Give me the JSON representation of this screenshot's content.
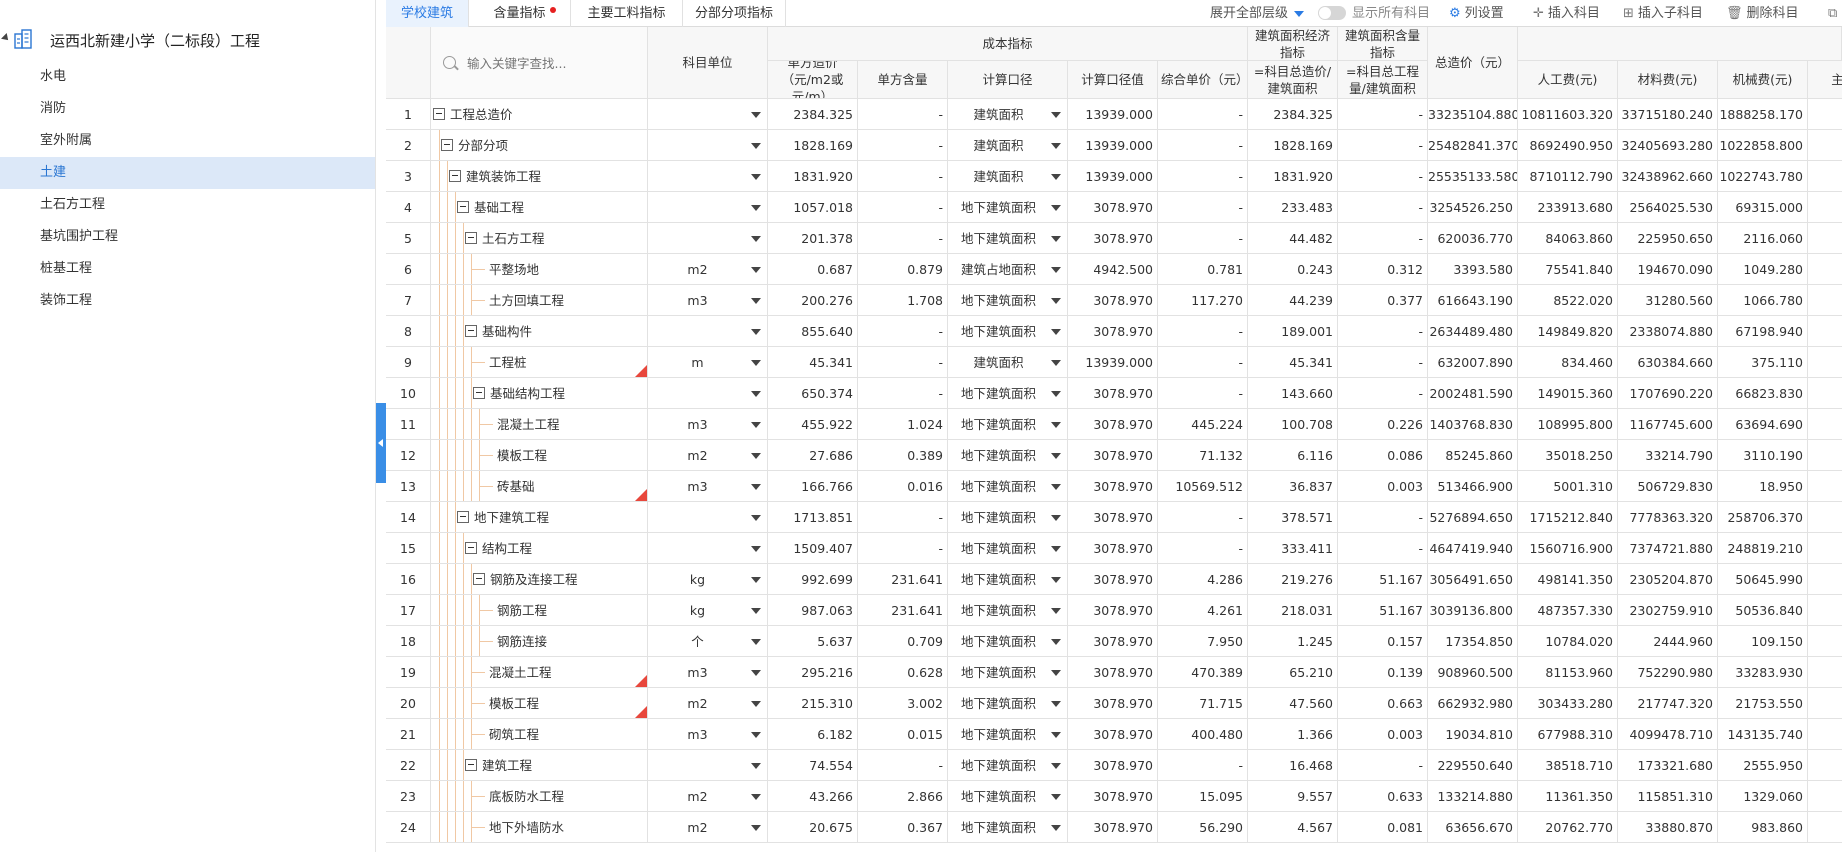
{
  "sidebar": {
    "project_title": "运西北新建小学（二标段）工程",
    "items": [
      {
        "label": "水电",
        "active": false
      },
      {
        "label": "消防",
        "active": false
      },
      {
        "label": "室外附属",
        "active": false
      },
      {
        "label": "土建",
        "active": true
      },
      {
        "label": "土石方工程",
        "active": false
      },
      {
        "label": "基坑围护工程",
        "active": false
      },
      {
        "label": "桩基工程",
        "active": false
      },
      {
        "label": "装饰工程",
        "active": false
      }
    ]
  },
  "tabs": [
    {
      "label": "学校建筑",
      "active": true,
      "dot": false
    },
    {
      "label": "含量指标",
      "active": false,
      "dot": true
    },
    {
      "label": "主要工料指标",
      "active": false,
      "dot": false
    },
    {
      "label": "分部分项指标",
      "active": false,
      "dot": false
    }
  ],
  "toolbar": {
    "expand_label": "展开全部层级",
    "show_all_label": "显示所有科目",
    "column_settings": "列设置",
    "insert_item": "插入科目",
    "insert_child": "插入子科目",
    "delete_item": "删除科目"
  },
  "search": {
    "placeholder": "输入关键字查找..."
  },
  "headers": {
    "unit": "科目单位",
    "cost_group": "成本指标",
    "unit_cost": "单方造价（元/m2或元/m）",
    "unit_qty": "单方含量",
    "calc_basis": "计算口径",
    "calc_value": "计算口径值",
    "comp_price": "综合单价（元）",
    "area_econ": "建筑面积经济指标",
    "area_econ_formula": "=科目总造价/建筑面积",
    "area_qty": "建筑面积含量指标",
    "area_qty_formula": "=科目总工程量/建筑面积",
    "total": "总造价（元）",
    "labor": "人工费(元)",
    "material": "材料费(元)",
    "machine": "机械费(元)",
    "main_partial": "主"
  },
  "rows": [
    {
      "no": "1",
      "level": 0,
      "exp": true,
      "name": "工程总造价",
      "unit": "",
      "flag": false,
      "unit_cost": "2384.325",
      "unit_qty": "-",
      "basis": "建筑面积",
      "basis_val": "13939.000",
      "comp": "-",
      "econ": "2384.325",
      "qtyi": "-",
      "total": "33235104.880",
      "labor": "10811603.320",
      "material": "33715180.240",
      "machine": "1888258.170"
    },
    {
      "no": "2",
      "level": 1,
      "exp": true,
      "name": "分部分项",
      "unit": "",
      "flag": false,
      "unit_cost": "1828.169",
      "unit_qty": "-",
      "basis": "建筑面积",
      "basis_val": "13939.000",
      "comp": "-",
      "econ": "1828.169",
      "qtyi": "-",
      "total": "25482841.370",
      "labor": "8692490.950",
      "material": "32405693.280",
      "machine": "1022858.800"
    },
    {
      "no": "3",
      "level": 2,
      "exp": true,
      "name": "建筑装饰工程",
      "unit": "",
      "flag": false,
      "unit_cost": "1831.920",
      "unit_qty": "-",
      "basis": "建筑面积",
      "basis_val": "13939.000",
      "comp": "-",
      "econ": "1831.920",
      "qtyi": "-",
      "total": "25535133.580",
      "labor": "8710112.790",
      "material": "32438962.660",
      "machine": "1022743.780"
    },
    {
      "no": "4",
      "level": 3,
      "exp": true,
      "name": "基础工程",
      "unit": "",
      "flag": false,
      "unit_cost": "1057.018",
      "unit_qty": "-",
      "basis": "地下建筑面积",
      "basis_val": "3078.970",
      "comp": "-",
      "econ": "233.483",
      "qtyi": "-",
      "total": "3254526.250",
      "labor": "233913.680",
      "material": "2564025.530",
      "machine": "69315.000"
    },
    {
      "no": "5",
      "level": 4,
      "exp": true,
      "name": "土石方工程",
      "unit": "",
      "flag": false,
      "unit_cost": "201.378",
      "unit_qty": "-",
      "basis": "地下建筑面积",
      "basis_val": "3078.970",
      "comp": "-",
      "econ": "44.482",
      "qtyi": "-",
      "total": "620036.770",
      "labor": "84063.860",
      "material": "225950.650",
      "machine": "2116.060"
    },
    {
      "no": "6",
      "level": 5,
      "exp": false,
      "name": "平整场地",
      "unit": "m2",
      "flag": false,
      "unit_cost": "0.687",
      "unit_qty": "0.879",
      "basis": "建筑占地面积",
      "basis_val": "4942.500",
      "comp": "0.781",
      "econ": "0.243",
      "qtyi": "0.312",
      "total": "3393.580",
      "labor": "75541.840",
      "material": "194670.090",
      "machine": "1049.280"
    },
    {
      "no": "7",
      "level": 5,
      "exp": false,
      "name": "土方回填工程",
      "unit": "m3",
      "flag": false,
      "unit_cost": "200.276",
      "unit_qty": "1.708",
      "basis": "地下建筑面积",
      "basis_val": "3078.970",
      "comp": "117.270",
      "econ": "44.239",
      "qtyi": "0.377",
      "total": "616643.190",
      "labor": "8522.020",
      "material": "31280.560",
      "machine": "1066.780"
    },
    {
      "no": "8",
      "level": 4,
      "exp": true,
      "name": "基础构件",
      "unit": "",
      "flag": false,
      "unit_cost": "855.640",
      "unit_qty": "-",
      "basis": "地下建筑面积",
      "basis_val": "3078.970",
      "comp": "-",
      "econ": "189.001",
      "qtyi": "-",
      "total": "2634489.480",
      "labor": "149849.820",
      "material": "2338074.880",
      "machine": "67198.940"
    },
    {
      "no": "9",
      "level": 5,
      "exp": false,
      "name": "工程桩",
      "unit": "m",
      "flag": true,
      "unit_cost": "45.341",
      "unit_qty": "-",
      "basis": "建筑面积",
      "basis_val": "13939.000",
      "comp": "-",
      "econ": "45.341",
      "qtyi": "-",
      "total": "632007.890",
      "labor": "834.460",
      "material": "630384.660",
      "machine": "375.110"
    },
    {
      "no": "10",
      "level": 5,
      "exp": true,
      "name": "基础结构工程",
      "unit": "",
      "flag": false,
      "unit_cost": "650.374",
      "unit_qty": "-",
      "basis": "地下建筑面积",
      "basis_val": "3078.970",
      "comp": "-",
      "econ": "143.660",
      "qtyi": "-",
      "total": "2002481.590",
      "labor": "149015.360",
      "material": "1707690.220",
      "machine": "66823.830"
    },
    {
      "no": "11",
      "level": 6,
      "exp": false,
      "name": "混凝土工程",
      "unit": "m3",
      "flag": false,
      "unit_cost": "455.922",
      "unit_qty": "1.024",
      "basis": "地下建筑面积",
      "basis_val": "3078.970",
      "comp": "445.224",
      "econ": "100.708",
      "qtyi": "0.226",
      "total": "1403768.830",
      "labor": "108995.800",
      "material": "1167745.600",
      "machine": "63694.690"
    },
    {
      "no": "12",
      "level": 6,
      "exp": false,
      "name": "模板工程",
      "unit": "m2",
      "flag": false,
      "unit_cost": "27.686",
      "unit_qty": "0.389",
      "basis": "地下建筑面积",
      "basis_val": "3078.970",
      "comp": "71.132",
      "econ": "6.116",
      "qtyi": "0.086",
      "total": "85245.860",
      "labor": "35018.250",
      "material": "33214.790",
      "machine": "3110.190"
    },
    {
      "no": "13",
      "level": 6,
      "exp": false,
      "name": "砖基础",
      "unit": "m3",
      "flag": true,
      "unit_cost": "166.766",
      "unit_qty": "0.016",
      "basis": "地下建筑面积",
      "basis_val": "3078.970",
      "comp": "10569.512",
      "econ": "36.837",
      "qtyi": "0.003",
      "total": "513466.900",
      "labor": "5001.310",
      "material": "506729.830",
      "machine": "18.950"
    },
    {
      "no": "14",
      "level": 3,
      "exp": true,
      "name": "地下建筑工程",
      "unit": "",
      "flag": false,
      "unit_cost": "1713.851",
      "unit_qty": "-",
      "basis": "地下建筑面积",
      "basis_val": "3078.970",
      "comp": "-",
      "econ": "378.571",
      "qtyi": "-",
      "total": "5276894.650",
      "labor": "1715212.840",
      "material": "7778363.320",
      "machine": "258706.370"
    },
    {
      "no": "15",
      "level": 4,
      "exp": true,
      "name": "结构工程",
      "unit": "",
      "flag": false,
      "unit_cost": "1509.407",
      "unit_qty": "-",
      "basis": "地下建筑面积",
      "basis_val": "3078.970",
      "comp": "-",
      "econ": "333.411",
      "qtyi": "-",
      "total": "4647419.940",
      "labor": "1560716.900",
      "material": "7374721.880",
      "machine": "248819.210"
    },
    {
      "no": "16",
      "level": 5,
      "exp": true,
      "name": "钢筋及连接工程",
      "unit": "kg",
      "flag": false,
      "unit_cost": "992.699",
      "unit_qty": "231.641",
      "basis": "地下建筑面积",
      "basis_val": "3078.970",
      "comp": "4.286",
      "econ": "219.276",
      "qtyi": "51.167",
      "total": "3056491.650",
      "labor": "498141.350",
      "material": "2305204.870",
      "machine": "50645.990"
    },
    {
      "no": "17",
      "level": 6,
      "exp": false,
      "name": "钢筋工程",
      "unit": "kg",
      "flag": false,
      "unit_cost": "987.063",
      "unit_qty": "231.641",
      "basis": "地下建筑面积",
      "basis_val": "3078.970",
      "comp": "4.261",
      "econ": "218.031",
      "qtyi": "51.167",
      "total": "3039136.800",
      "labor": "487357.330",
      "material": "2302759.910",
      "machine": "50536.840"
    },
    {
      "no": "18",
      "level": 6,
      "exp": false,
      "name": "钢筋连接",
      "unit": "个",
      "flag": false,
      "unit_cost": "5.637",
      "unit_qty": "0.709",
      "basis": "地下建筑面积",
      "basis_val": "3078.970",
      "comp": "7.950",
      "econ": "1.245",
      "qtyi": "0.157",
      "total": "17354.850",
      "labor": "10784.020",
      "material": "2444.960",
      "machine": "109.150"
    },
    {
      "no": "19",
      "level": 5,
      "exp": false,
      "name": "混凝土工程",
      "unit": "m3",
      "flag": true,
      "unit_cost": "295.216",
      "unit_qty": "0.628",
      "basis": "地下建筑面积",
      "basis_val": "3078.970",
      "comp": "470.389",
      "econ": "65.210",
      "qtyi": "0.139",
      "total": "908960.500",
      "labor": "81153.960",
      "material": "752290.980",
      "machine": "33283.930"
    },
    {
      "no": "20",
      "level": 5,
      "exp": false,
      "name": "模板工程",
      "unit": "m2",
      "flag": true,
      "unit_cost": "215.310",
      "unit_qty": "3.002",
      "basis": "地下建筑面积",
      "basis_val": "3078.970",
      "comp": "71.715",
      "econ": "47.560",
      "qtyi": "0.663",
      "total": "662932.980",
      "labor": "303433.280",
      "material": "217747.320",
      "machine": "21753.550"
    },
    {
      "no": "21",
      "level": 5,
      "exp": false,
      "name": "砌筑工程",
      "unit": "m3",
      "flag": false,
      "unit_cost": "6.182",
      "unit_qty": "0.015",
      "basis": "地下建筑面积",
      "basis_val": "3078.970",
      "comp": "400.480",
      "econ": "1.366",
      "qtyi": "0.003",
      "total": "19034.810",
      "labor": "677988.310",
      "material": "4099478.710",
      "machine": "143135.740"
    },
    {
      "no": "22",
      "level": 4,
      "exp": true,
      "name": "建筑工程",
      "unit": "",
      "flag": false,
      "unit_cost": "74.554",
      "unit_qty": "-",
      "basis": "地下建筑面积",
      "basis_val": "3078.970",
      "comp": "-",
      "econ": "16.468",
      "qtyi": "-",
      "total": "229550.640",
      "labor": "38518.710",
      "material": "173321.680",
      "machine": "2555.950"
    },
    {
      "no": "23",
      "level": 5,
      "exp": false,
      "name": "底板防水工程",
      "unit": "m2",
      "flag": false,
      "unit_cost": "43.266",
      "unit_qty": "2.866",
      "basis": "地下建筑面积",
      "basis_val": "3078.970",
      "comp": "15.095",
      "econ": "9.557",
      "qtyi": "0.633",
      "total": "133214.880",
      "labor": "11361.350",
      "material": "115851.310",
      "machine": "1329.060"
    },
    {
      "no": "24",
      "level": 5,
      "exp": false,
      "name": "地下外墙防水",
      "unit": "m2",
      "flag": false,
      "unit_cost": "20.675",
      "unit_qty": "0.367",
      "basis": "地下建筑面积",
      "basis_val": "3078.970",
      "comp": "56.290",
      "econ": "4.567",
      "qtyi": "0.081",
      "total": "63656.670",
      "labor": "20762.770",
      "material": "33880.870",
      "machine": "983.860"
    }
  ]
}
